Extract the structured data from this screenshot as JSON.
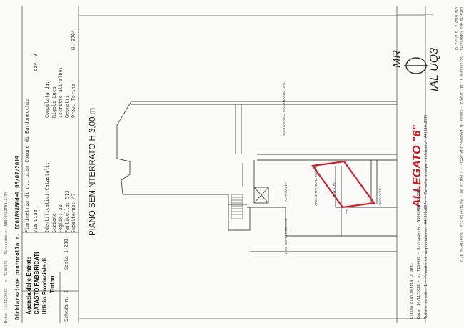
{
  "header": {
    "rilascio_strip": "Data: 14/11/2022 - n. T236478 - Richiedente: NBDCHR82P03L219Y",
    "protocol_line": "Dichiarazione protocollo n. TO0189860del 05/07/2019",
    "plan_title": "Planimetria di u.i.u.in Comune di Bardonecchia",
    "address": "Via Diaz",
    "civ": "civ. 9",
    "identificativi": "Identificativi Catastali:",
    "sezione": "Sezione:",
    "foglio": "Foglio: 30",
    "particella": "Particella: 513",
    "subalterno": "Subalterno: 47",
    "compilata": "Compilata da:",
    "compilatore": "Rigoli Luca",
    "iscritto": "Iscritto all'albo:",
    "albo": "Geometri",
    "prov": "Prov. Torino",
    "num": "N. 9704"
  },
  "agency": {
    "line1": "Agenzia delle Entrate",
    "line2": "CATASTO FABBRICATI",
    "line3": "Ufficio Provinciale di",
    "line4": "Torino"
  },
  "scheda": {
    "label": "Scheda n. 1",
    "scala": "Scala 1:200"
  },
  "plan": {
    "main_label": "PIANO SEMINTERRATO H 3,00 m",
    "top_street": "SOTTOSUOLO VIA ARMANDO DIAZ",
    "corridor": "AREA DI MANOVRA COMUNE",
    "box_label": "BOX AUTO",
    "altra_left": "ALTRA UNITA'",
    "altra_right": "ALTRA UNITA'",
    "ct": "C.T.",
    "lato_cortile": "LATO CORTILE COMUNE"
  },
  "annotations": {
    "allegato": "ALLEGATO \"6\"",
    "hand_top": "MR",
    "hand_right": "IAL UQ3"
  },
  "footer": {
    "ultima": "Ultima planimetria in atti",
    "data_line": "Data: 14/11/2022 - n. T236478 - Richiedente: NBDCHR82P03L219Y",
    "formato_line": "Totale schede: 1 - Formato di acquisizione: A4(210x297) - Formato stampa richiesto: A4(210x297)"
  },
  "right_margin": {
    "line1": "Catasto dei Fabbricati - Situazione al 14/11/2022 - Comune di BARDONECCHIA(A651) - < Foglio 30 - Particella 513 - Subalterno 47 >",
    "line2": "VIA DIAZ n. 9 Piano S1"
  }
}
